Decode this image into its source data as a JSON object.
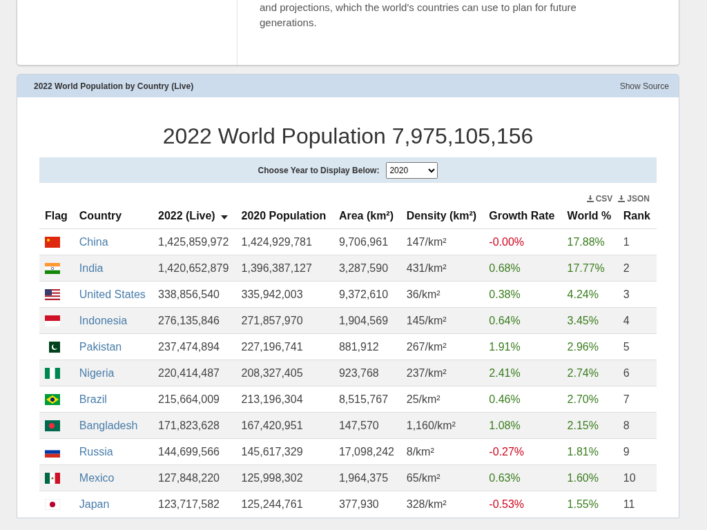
{
  "intro": {
    "lines": [
      "and projections, which the world's countries can use to plan for future",
      "generations."
    ]
  },
  "panel": {
    "title": "2022 World Population by Country (Live)",
    "source_link": "Show Source"
  },
  "headline": "2022 World Population 7,975,105,156",
  "year_picker": {
    "label": "Choose Year to Display Below:",
    "value": "2020"
  },
  "downloads": [
    "CSV",
    "JSON"
  ],
  "table": {
    "columns": [
      {
        "label": "Flag",
        "sorted": false
      },
      {
        "label": "Country",
        "sorted": false
      },
      {
        "label": "2022 (Live)",
        "sorted": true
      },
      {
        "label": "2020 Population",
        "sorted": false
      },
      {
        "label": "Area (km²)",
        "sorted": false
      },
      {
        "label": "Density (km²)",
        "sorted": false
      },
      {
        "label": "Growth Rate",
        "sorted": false
      },
      {
        "label": "World %",
        "sorted": false
      },
      {
        "label": "Rank",
        "sorted": false
      }
    ],
    "rows": [
      {
        "kind": "china",
        "country": "China",
        "live": "1,425,859,972",
        "pop2020": "1,424,929,781",
        "area": "9,706,961",
        "density": "147/km²",
        "growth": "-0.00%",
        "negative": true,
        "world": "17.88%",
        "rank": "1"
      },
      {
        "kind": "india",
        "country": "India",
        "live": "1,420,652,879",
        "pop2020": "1,396,387,127",
        "area": "3,287,590",
        "density": "431/km²",
        "growth": "0.68%",
        "negative": false,
        "world": "17.77%",
        "rank": "2"
      },
      {
        "kind": "usa",
        "country": "United States",
        "live": "338,856,540",
        "pop2020": "335,942,003",
        "area": "9,372,610",
        "density": "36/km²",
        "growth": "0.38%",
        "negative": false,
        "world": "4.24%",
        "rank": "3"
      },
      {
        "kind": "indonesia",
        "country": "Indonesia",
        "live": "276,135,846",
        "pop2020": "271,857,970",
        "area": "1,904,569",
        "density": "145/km²",
        "growth": "0.64%",
        "negative": false,
        "world": "3.45%",
        "rank": "4"
      },
      {
        "kind": "pakistan",
        "country": "Pakistan",
        "live": "237,474,894",
        "pop2020": "227,196,741",
        "area": "881,912",
        "density": "267/km²",
        "growth": "1.91%",
        "negative": false,
        "world": "2.96%",
        "rank": "5"
      },
      {
        "kind": "nigeria",
        "country": "Nigeria",
        "live": "220,414,487",
        "pop2020": "208,327,405",
        "area": "923,768",
        "density": "237/km²",
        "growth": "2.41%",
        "negative": false,
        "world": "2.74%",
        "rank": "6"
      },
      {
        "kind": "brazil",
        "country": "Brazil",
        "live": "215,664,009",
        "pop2020": "213,196,304",
        "area": "8,515,767",
        "density": "25/km²",
        "growth": "0.46%",
        "negative": false,
        "world": "2.70%",
        "rank": "7"
      },
      {
        "kind": "bangladesh",
        "country": "Bangladesh",
        "live": "171,823,628",
        "pop2020": "167,420,951",
        "area": "147,570",
        "density": "1,160/km²",
        "growth": "1.08%",
        "negative": false,
        "world": "2.15%",
        "rank": "8"
      },
      {
        "kind": "russia",
        "country": "Russia",
        "live": "144,699,566",
        "pop2020": "145,617,329",
        "area": "17,098,242",
        "density": "8/km²",
        "growth": "-0.27%",
        "negative": true,
        "world": "1.81%",
        "rank": "9"
      },
      {
        "kind": "mexico",
        "country": "Mexico",
        "live": "127,848,220",
        "pop2020": "125,998,302",
        "area": "1,964,375",
        "density": "65/km²",
        "growth": "0.63%",
        "negative": false,
        "world": "1.60%",
        "rank": "10"
      },
      {
        "kind": "japan",
        "country": "Japan",
        "live": "123,717,582",
        "pop2020": "125,244,761",
        "area": "377,930",
        "density": "328/km²",
        "growth": "-0.53%",
        "negative": true,
        "world": "1.55%",
        "rank": "11"
      }
    ]
  }
}
